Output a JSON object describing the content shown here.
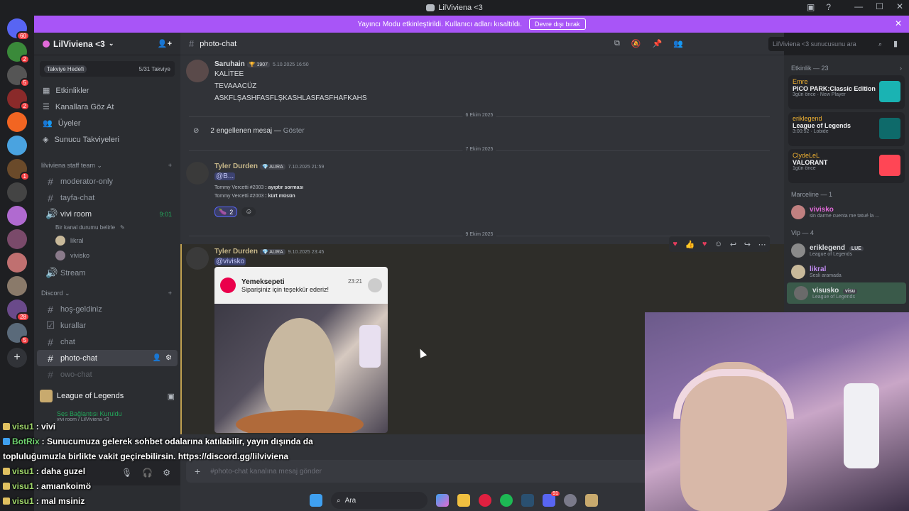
{
  "window": {
    "title": "LilViviena <3",
    "controls": [
      "—",
      "☐",
      "✕"
    ]
  },
  "banner": {
    "text": "Yayıncı Modu etkinleştirildi. Kullanıcı adları kısaltıldı.",
    "button": "Devre dışı bırak"
  },
  "server_rail": [
    {
      "badge": "60",
      "color": "#5865f2"
    },
    {
      "badge": "2",
      "color": "#3a8a3a"
    },
    {
      "badge": "5",
      "color": "#555"
    },
    {
      "badge": "2",
      "color": "#8a2a2a"
    },
    {
      "badge": "",
      "color": "#f26522"
    },
    {
      "badge": "",
      "color": "#4aa3e0"
    },
    {
      "badge": "1",
      "color": "#6a4a2a"
    },
    {
      "badge": "",
      "color": "#444"
    },
    {
      "badge": "",
      "color": "#b06ad0"
    },
    {
      "badge": "",
      "color": "#7a4a6a"
    },
    {
      "badge": "",
      "color": "#c07070"
    },
    {
      "badge": "",
      "color": "#8a7a6a"
    },
    {
      "badge": "28",
      "color": "#6a4a8a"
    },
    {
      "badge": "5",
      "color": "#5a6a7a"
    }
  ],
  "sidebar": {
    "guild_name": "LilViviena <3",
    "boost": {
      "label": "Takviye Hedefi",
      "progress": "5/31 Takviye"
    },
    "nav": [
      {
        "icon": "calendar-icon",
        "label": "Etkinlikler"
      },
      {
        "icon": "browse-icon",
        "label": "Kanallara Göz At"
      },
      {
        "icon": "members-icon",
        "label": "Üyeler"
      },
      {
        "icon": "boost-icon",
        "label": "Sunucu Takviyeleri"
      }
    ],
    "category1": "lilviviena staff team",
    "channels1": [
      "moderator-only",
      "tayfa-chat"
    ],
    "voice": {
      "name": "vivi room",
      "time": "9:01",
      "status": "Bir kanal durumu belirle",
      "users": [
        "likral",
        "vivisko"
      ]
    },
    "stream": "Stream",
    "category2": "Discord",
    "channels2": [
      "hoş-geldiniz",
      "kurallar",
      "chat",
      "photo-chat",
      "owo-chat"
    ],
    "game": "League of Legends",
    "voice_status": "Ses Bağlantısı Kuruldu",
    "voice_sub": "vivi room / LilViviena <3"
  },
  "channel": {
    "name": "photo-chat",
    "search_placeholder": "LilViviena <3 sunucusunu ara"
  },
  "messages": {
    "m1": {
      "user": "Saruhain",
      "badge": "1907",
      "time": "5.10.2025 16:50",
      "lines": [
        "KALİTEE",
        "TEVAAACÜZ",
        "ASKFLŞASHFASFLŞKASHLASFASFHAFKAHS"
      ]
    },
    "date1": "6 Ekim 2025",
    "blocked": {
      "text": "2 engellenen mesaj —",
      "link": "Göster"
    },
    "date2": "7 Ekim 2025",
    "m2": {
      "user": "Tyler Durden",
      "badge": "AURA",
      "time": "7.10.2025 21:59",
      "mention": "@B...",
      "q1a": "Tommy Vercetti #2003",
      "q1b": ": ayıptır sorması",
      "q2a": "Tommy Vercetti #2003",
      "q2b": ": kürt müsün",
      "reaction_count": "2"
    },
    "date3": "9 Ekim 2025",
    "m3": {
      "user": "Tyler Durden",
      "badge": "AURA",
      "time": "9.10.2025 23:45",
      "mention": "@vivisko",
      "notif_app": "Yemeksepeti",
      "notif_time": "23:21",
      "notif_text": "Siparişiniz için teşekkür ederiz!"
    },
    "composer_placeholder": "#photo-chat kanalına mesaj gönder"
  },
  "members": {
    "activity_header": "Etkinlik — 23",
    "activities": [
      {
        "user": "Emre",
        "game": "PICO PARK:Classic Edition",
        "sub": "3gün önce · New Player",
        "thumb": "#1ab3b3"
      },
      {
        "user": "eriklegend",
        "game": "League of Legends",
        "sub": "3:00:52 · Lobide",
        "thumb": "#0e6a6a"
      },
      {
        "user": "ClydeLeL",
        "game": "VALORANT",
        "sub": "1gün önce",
        "thumb": "#ff4655"
      }
    ],
    "group1": "Marceline — 1",
    "marceline": [
      {
        "name": "vivisko",
        "status": "sin darme cuenta me tatué la ...",
        "color": "#e26ad9"
      }
    ],
    "group2": "Vip — 4",
    "vip": [
      {
        "name": "eriklegend",
        "tag": "LUE",
        "status": "League of Legends",
        "color": "#dbdee1"
      },
      {
        "name": "likral",
        "tag": "",
        "status": "Sesli aramada",
        "color": "#c08af0"
      },
      {
        "name": "visusko",
        "tag": "visu",
        "status": "League of Legends",
        "color": "#f2f3f5"
      }
    ]
  },
  "stream_chat": [
    {
      "name": "visu1",
      "text": ": vivi",
      "kind": "user"
    },
    {
      "name": "BotRix",
      "text": ": Sunucumuza gelerek sohbet odalarına katılabilir, yayın dışında da",
      "kind": "bot"
    },
    {
      "name": "",
      "text": "topluluğumuzla birlikte vakit geçirebilirsin. https://discord.gg/lilviviena",
      "kind": "cont"
    },
    {
      "name": "visu1",
      "text": ": daha guzel",
      "kind": "user"
    },
    {
      "name": "visu1",
      "text": ": amıankoimö",
      "kind": "user"
    },
    {
      "name": "visu1",
      "text": ": mal msiniz",
      "kind": "user"
    }
  ],
  "taskbar": {
    "search": "Ara",
    "discord_badge": "91"
  }
}
